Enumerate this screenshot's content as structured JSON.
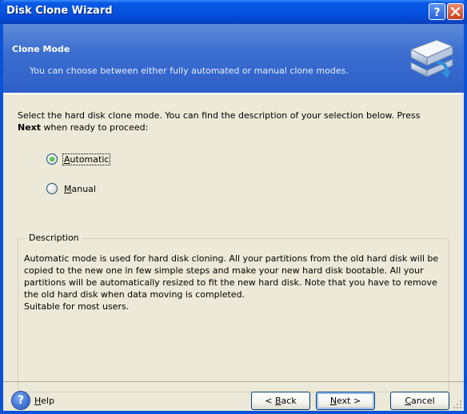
{
  "window": {
    "title": "Disk Clone Wizard",
    "help_button": "?",
    "close_button": "X"
  },
  "header": {
    "title": "Clone Mode",
    "subtitle": "You can choose between either fully automated or manual clone modes."
  },
  "body": {
    "instruction_line1": "Select the hard disk clone mode. You can find the description of your selection below. Press",
    "instruction_bold": "Next",
    "instruction_line2_rest": " when ready to proceed:",
    "options": [
      {
        "label": "Automatic",
        "selected": true
      },
      {
        "label": "Manual",
        "selected": false
      }
    ]
  },
  "description": {
    "legend": "Description",
    "lines": [
      "Automatic mode is used for hard disk cloning. All your partitions from the old hard disk will be",
      "copied to the new one in few simple steps and make your new hard disk bootable. All your",
      "partitions will be automatically resized to fit the new hard disk. Note that you have to remove",
      "the old hard disk when data moving is completed.",
      "Suitable for most users."
    ]
  },
  "footer": {
    "help_label": "Help",
    "back_label": "< Back",
    "next_label": "Next >",
    "cancel_label": "Cancel"
  },
  "colors": {
    "titlebar": "#0553e0",
    "header": "#3c6fd0",
    "client_bg": "#ece9d8",
    "radio_dot": "#21a121"
  }
}
